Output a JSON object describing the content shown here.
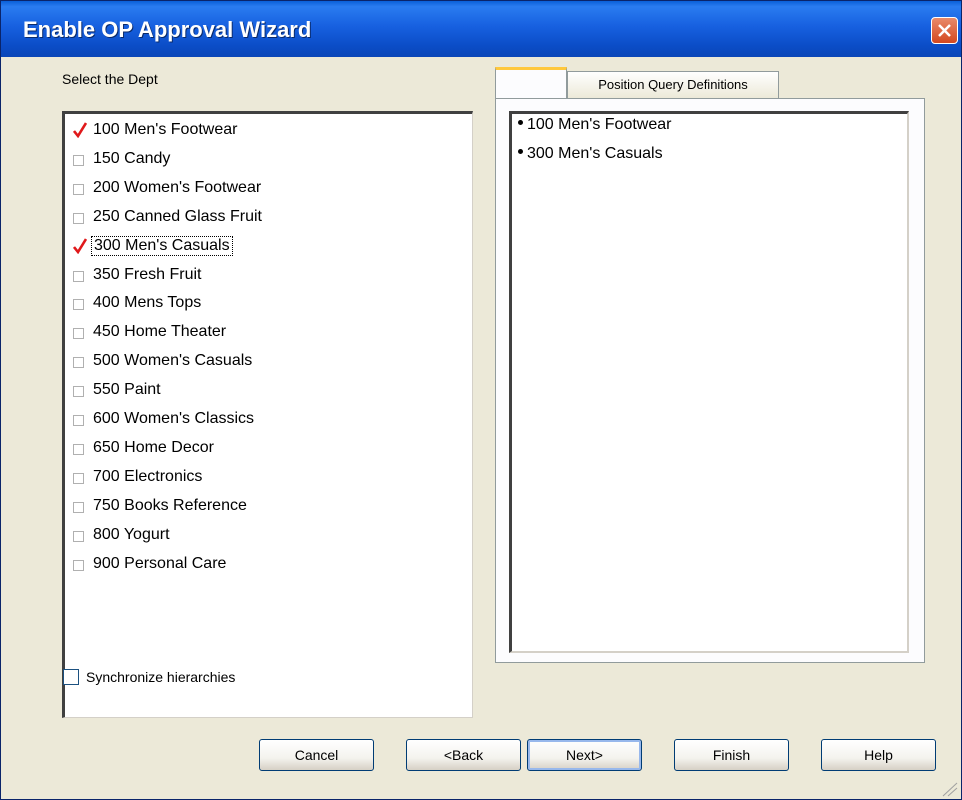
{
  "window": {
    "title": "Enable OP Approval Wizard"
  },
  "dept_selector": {
    "label": "Select the Dept",
    "items": [
      {
        "label": "100 Men's Footwear",
        "checked": true
      },
      {
        "label": "150 Candy",
        "checked": false
      },
      {
        "label": "200 Women's Footwear",
        "checked": false
      },
      {
        "label": "250 Canned Glass Fruit",
        "checked": false
      },
      {
        "label": "300 Men's Casuals",
        "checked": true,
        "focused": true
      },
      {
        "label": "350 Fresh Fruit",
        "checked": false
      },
      {
        "label": "400 Mens Tops",
        "checked": false
      },
      {
        "label": "450 Home Theater",
        "checked": false
      },
      {
        "label": "500 Women's Casuals",
        "checked": false
      },
      {
        "label": "550 Paint",
        "checked": false
      },
      {
        "label": "600 Women's Classics",
        "checked": false
      },
      {
        "label": "650 Home Decor",
        "checked": false
      },
      {
        "label": "700 Electronics",
        "checked": false
      },
      {
        "label": "750 Books Reference",
        "checked": false
      },
      {
        "label": "800 Yogurt",
        "checked": false
      },
      {
        "label": "900 Personal Care",
        "checked": false
      }
    ]
  },
  "sync": {
    "label": "Synchronize hierarchies",
    "checked": false
  },
  "tabs": [
    {
      "label": "",
      "active": true
    },
    {
      "label": "Position Query Definitions",
      "active": false
    }
  ],
  "selected_panel": {
    "items": [
      "100 Men's Footwear",
      "300 Men's Casuals"
    ]
  },
  "buttons": {
    "cancel": "Cancel",
    "back": "<Back",
    "next": "Next>",
    "finish": "Finish",
    "help": "Help"
  },
  "colors": {
    "titlebar": "#0a5fd8",
    "check_mark": "#e0191b",
    "dialog_bg": "#ece9d8",
    "active_tab_accent": "#ffc83c"
  }
}
